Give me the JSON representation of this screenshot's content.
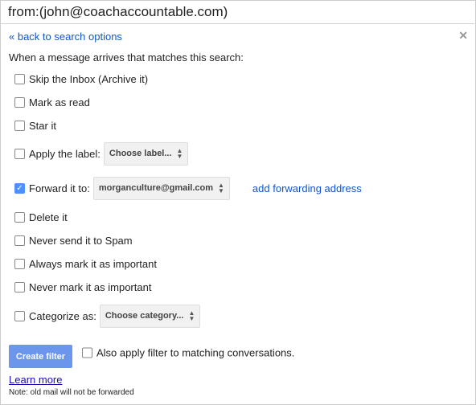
{
  "search": {
    "query": "from:(john@coachaccountable.com)"
  },
  "close_icon": "close-icon",
  "back_link": "« back to search options",
  "intro": "When a message arrives that matches this search:",
  "actions": [
    {
      "label": "Skip the Inbox (Archive it)",
      "checked": false
    },
    {
      "label": "Mark as read",
      "checked": false
    },
    {
      "label": "Star it",
      "checked": false
    },
    {
      "label": "Apply the label:",
      "checked": false,
      "select": "Choose label..."
    },
    {
      "label": "Forward it to:",
      "checked": true,
      "select": "morganculture@gmail.com",
      "link": "add forwarding address"
    },
    {
      "label": "Delete it",
      "checked": false
    },
    {
      "label": "Never send it to Spam",
      "checked": false
    },
    {
      "label": "Always mark it as important",
      "checked": false
    },
    {
      "label": "Never mark it as important",
      "checked": false
    },
    {
      "label": "Categorize as:",
      "checked": false,
      "select": "Choose category..."
    }
  ],
  "create_filter": "Create filter",
  "also_apply": {
    "label": "Also apply filter to matching conversations.",
    "checked": false
  },
  "learn_more": "Learn more",
  "note": "Note: old mail will not be forwarded",
  "colors": {
    "accent": "#4d90fe",
    "button": "#6b96ec",
    "link": "#1155cc"
  }
}
